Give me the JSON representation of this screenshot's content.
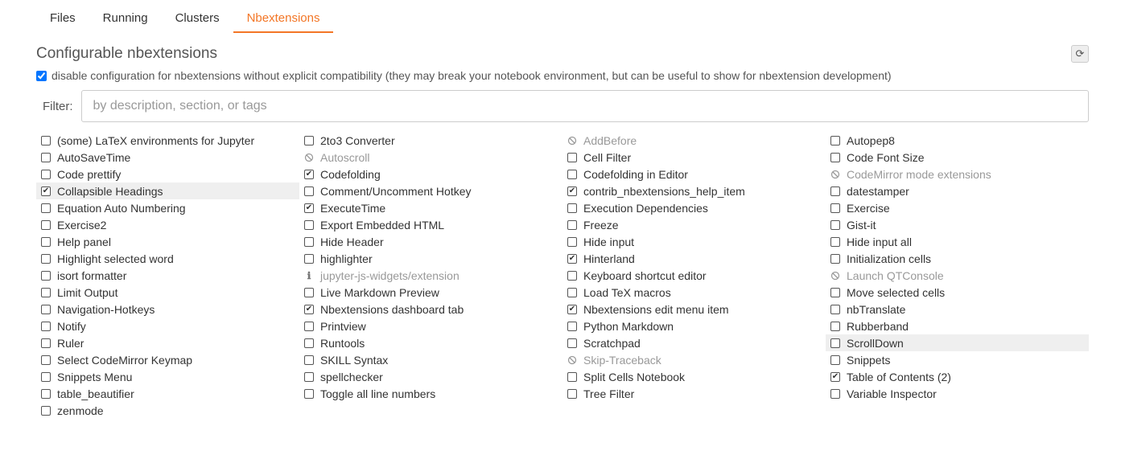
{
  "tabs": [
    {
      "label": "Files",
      "active": false
    },
    {
      "label": "Running",
      "active": false
    },
    {
      "label": "Clusters",
      "active": false
    },
    {
      "label": "Nbextensions",
      "active": true
    }
  ],
  "section_title": "Configurable nbextensions",
  "refresh_icon": "refresh",
  "compat": {
    "checked": true,
    "label": "disable configuration for nbextensions without explicit compatibility (they may break your notebook environment, but can be useful to show for nbextension development)"
  },
  "filter": {
    "label": "Filter:",
    "placeholder": "by description, section, or tags",
    "value": ""
  },
  "extensions": [
    {
      "label": "(some) LaTeX environments for Jupyter",
      "checked": false,
      "icon": "box"
    },
    {
      "label": "2to3 Converter",
      "checked": false,
      "icon": "box"
    },
    {
      "label": "AddBefore",
      "checked": false,
      "icon": "ban",
      "disabled": true
    },
    {
      "label": "Autopep8",
      "checked": false,
      "icon": "box"
    },
    {
      "label": "AutoSaveTime",
      "checked": false,
      "icon": "box"
    },
    {
      "label": "Autoscroll",
      "checked": false,
      "icon": "ban",
      "disabled": true
    },
    {
      "label": "Cell Filter",
      "checked": false,
      "icon": "box"
    },
    {
      "label": "Code Font Size",
      "checked": false,
      "icon": "box"
    },
    {
      "label": "Code prettify",
      "checked": false,
      "icon": "box"
    },
    {
      "label": "Codefolding",
      "checked": true,
      "icon": "box"
    },
    {
      "label": "Codefolding in Editor",
      "checked": false,
      "icon": "box"
    },
    {
      "label": "CodeMirror mode extensions",
      "checked": false,
      "icon": "ban",
      "disabled": true
    },
    {
      "label": "Collapsible Headings",
      "checked": true,
      "icon": "box",
      "selected": true
    },
    {
      "label": "Comment/Uncomment Hotkey",
      "checked": false,
      "icon": "box"
    },
    {
      "label": "contrib_nbextensions_help_item",
      "checked": true,
      "icon": "box"
    },
    {
      "label": "datestamper",
      "checked": false,
      "icon": "box"
    },
    {
      "label": "Equation Auto Numbering",
      "checked": false,
      "icon": "box"
    },
    {
      "label": "ExecuteTime",
      "checked": true,
      "icon": "box"
    },
    {
      "label": "Execution Dependencies",
      "checked": false,
      "icon": "box"
    },
    {
      "label": "Exercise",
      "checked": false,
      "icon": "box"
    },
    {
      "label": "Exercise2",
      "checked": false,
      "icon": "box"
    },
    {
      "label": "Export Embedded HTML",
      "checked": false,
      "icon": "box"
    },
    {
      "label": "Freeze",
      "checked": false,
      "icon": "box"
    },
    {
      "label": "Gist-it",
      "checked": false,
      "icon": "box"
    },
    {
      "label": "Help panel",
      "checked": false,
      "icon": "box"
    },
    {
      "label": "Hide Header",
      "checked": false,
      "icon": "box"
    },
    {
      "label": "Hide input",
      "checked": false,
      "icon": "box"
    },
    {
      "label": "Hide input all",
      "checked": false,
      "icon": "box"
    },
    {
      "label": "Highlight selected word",
      "checked": false,
      "icon": "box"
    },
    {
      "label": "highlighter",
      "checked": false,
      "icon": "box"
    },
    {
      "label": "Hinterland",
      "checked": true,
      "icon": "box"
    },
    {
      "label": "Initialization cells",
      "checked": false,
      "icon": "box"
    },
    {
      "label": "isort formatter",
      "checked": false,
      "icon": "box"
    },
    {
      "label": "jupyter-js-widgets/extension",
      "checked": false,
      "icon": "info",
      "disabled": true
    },
    {
      "label": "Keyboard shortcut editor",
      "checked": false,
      "icon": "box"
    },
    {
      "label": "Launch QTConsole",
      "checked": false,
      "icon": "ban",
      "disabled": true
    },
    {
      "label": "Limit Output",
      "checked": false,
      "icon": "box"
    },
    {
      "label": "Live Markdown Preview",
      "checked": false,
      "icon": "box"
    },
    {
      "label": "Load TeX macros",
      "checked": false,
      "icon": "box"
    },
    {
      "label": "Move selected cells",
      "checked": false,
      "icon": "box"
    },
    {
      "label": "Navigation-Hotkeys",
      "checked": false,
      "icon": "box"
    },
    {
      "label": "Nbextensions dashboard tab",
      "checked": true,
      "icon": "box"
    },
    {
      "label": "Nbextensions edit menu item",
      "checked": true,
      "icon": "box"
    },
    {
      "label": "nbTranslate",
      "checked": false,
      "icon": "box"
    },
    {
      "label": "Notify",
      "checked": false,
      "icon": "box"
    },
    {
      "label": "Printview",
      "checked": false,
      "icon": "box"
    },
    {
      "label": "Python Markdown",
      "checked": false,
      "icon": "box"
    },
    {
      "label": "Rubberband",
      "checked": false,
      "icon": "box"
    },
    {
      "label": "Ruler",
      "checked": false,
      "icon": "box"
    },
    {
      "label": "Runtools",
      "checked": false,
      "icon": "box"
    },
    {
      "label": "Scratchpad",
      "checked": false,
      "icon": "box"
    },
    {
      "label": "ScrollDown",
      "checked": false,
      "icon": "box",
      "selected": true
    },
    {
      "label": "Select CodeMirror Keymap",
      "checked": false,
      "icon": "box"
    },
    {
      "label": "SKILL Syntax",
      "checked": false,
      "icon": "box"
    },
    {
      "label": "Skip-Traceback",
      "checked": false,
      "icon": "ban",
      "disabled": true
    },
    {
      "label": "Snippets",
      "checked": false,
      "icon": "box"
    },
    {
      "label": "Snippets Menu",
      "checked": false,
      "icon": "box"
    },
    {
      "label": "spellchecker",
      "checked": false,
      "icon": "box"
    },
    {
      "label": "Split Cells Notebook",
      "checked": false,
      "icon": "box"
    },
    {
      "label": "Table of Contents (2)",
      "checked": true,
      "icon": "box"
    },
    {
      "label": "table_beautifier",
      "checked": false,
      "icon": "box"
    },
    {
      "label": "Toggle all line numbers",
      "checked": false,
      "icon": "box"
    },
    {
      "label": "Tree Filter",
      "checked": false,
      "icon": "box"
    },
    {
      "label": "Variable Inspector",
      "checked": false,
      "icon": "box"
    },
    {
      "label": "zenmode",
      "checked": false,
      "icon": "box"
    }
  ]
}
